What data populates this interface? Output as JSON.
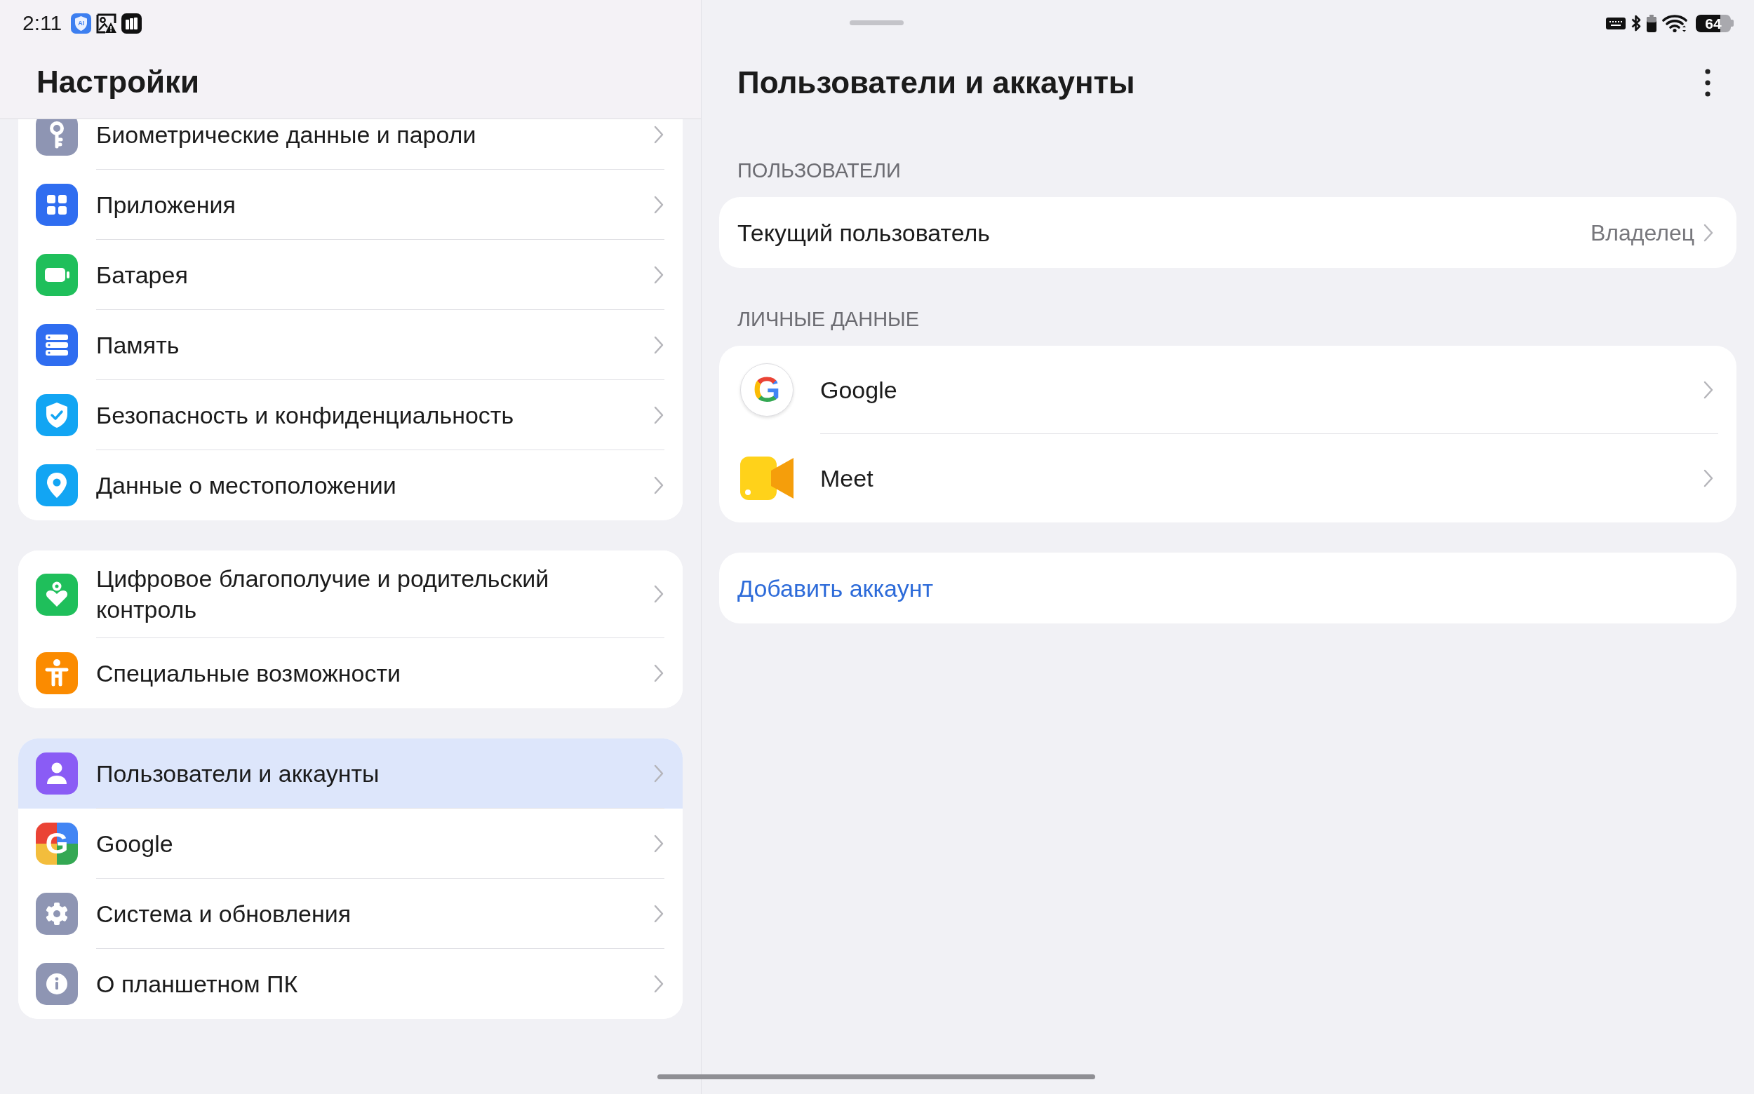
{
  "status_bar": {
    "time": "2:11",
    "ai_badge": "AI",
    "battery": "64"
  },
  "sidebar": {
    "title": "Настройки",
    "groups": [
      {
        "items": [
          {
            "label": "Биометрические данные и пароли",
            "selected": false
          },
          {
            "label": "Приложения",
            "selected": false
          },
          {
            "label": "Батарея",
            "selected": false
          },
          {
            "label": "Память",
            "selected": false
          },
          {
            "label": "Безопасность и конфиденциальность",
            "selected": false
          },
          {
            "label": "Данные о местоположении",
            "selected": false
          }
        ]
      },
      {
        "items": [
          {
            "label": "Цифровое благополучие и родительский контроль",
            "selected": false
          },
          {
            "label": "Специальные возможности",
            "selected": false
          }
        ]
      },
      {
        "items": [
          {
            "label": "Пользователи и аккаунты",
            "selected": true
          },
          {
            "label": "Google",
            "icon_letter": "G",
            "selected": false
          },
          {
            "label": "Система и обновления",
            "selected": false
          },
          {
            "label": "О планшетном ПК",
            "selected": false
          }
        ]
      }
    ]
  },
  "detail": {
    "title": "Пользователи и аккаунты",
    "sections": [
      {
        "heading": "ПОЛЬЗОВАТЕЛИ",
        "rows": [
          {
            "kind": "value",
            "label": "Текущий пользователь",
            "value": "Владелец"
          }
        ]
      },
      {
        "heading": "ЛИЧНЫЕ ДАННЫЕ",
        "rows": [
          {
            "kind": "account",
            "label": "Google",
            "icon_letter": "G"
          },
          {
            "kind": "account",
            "label": "Meet"
          }
        ]
      }
    ],
    "add_account": "Добавить аккаунт"
  }
}
